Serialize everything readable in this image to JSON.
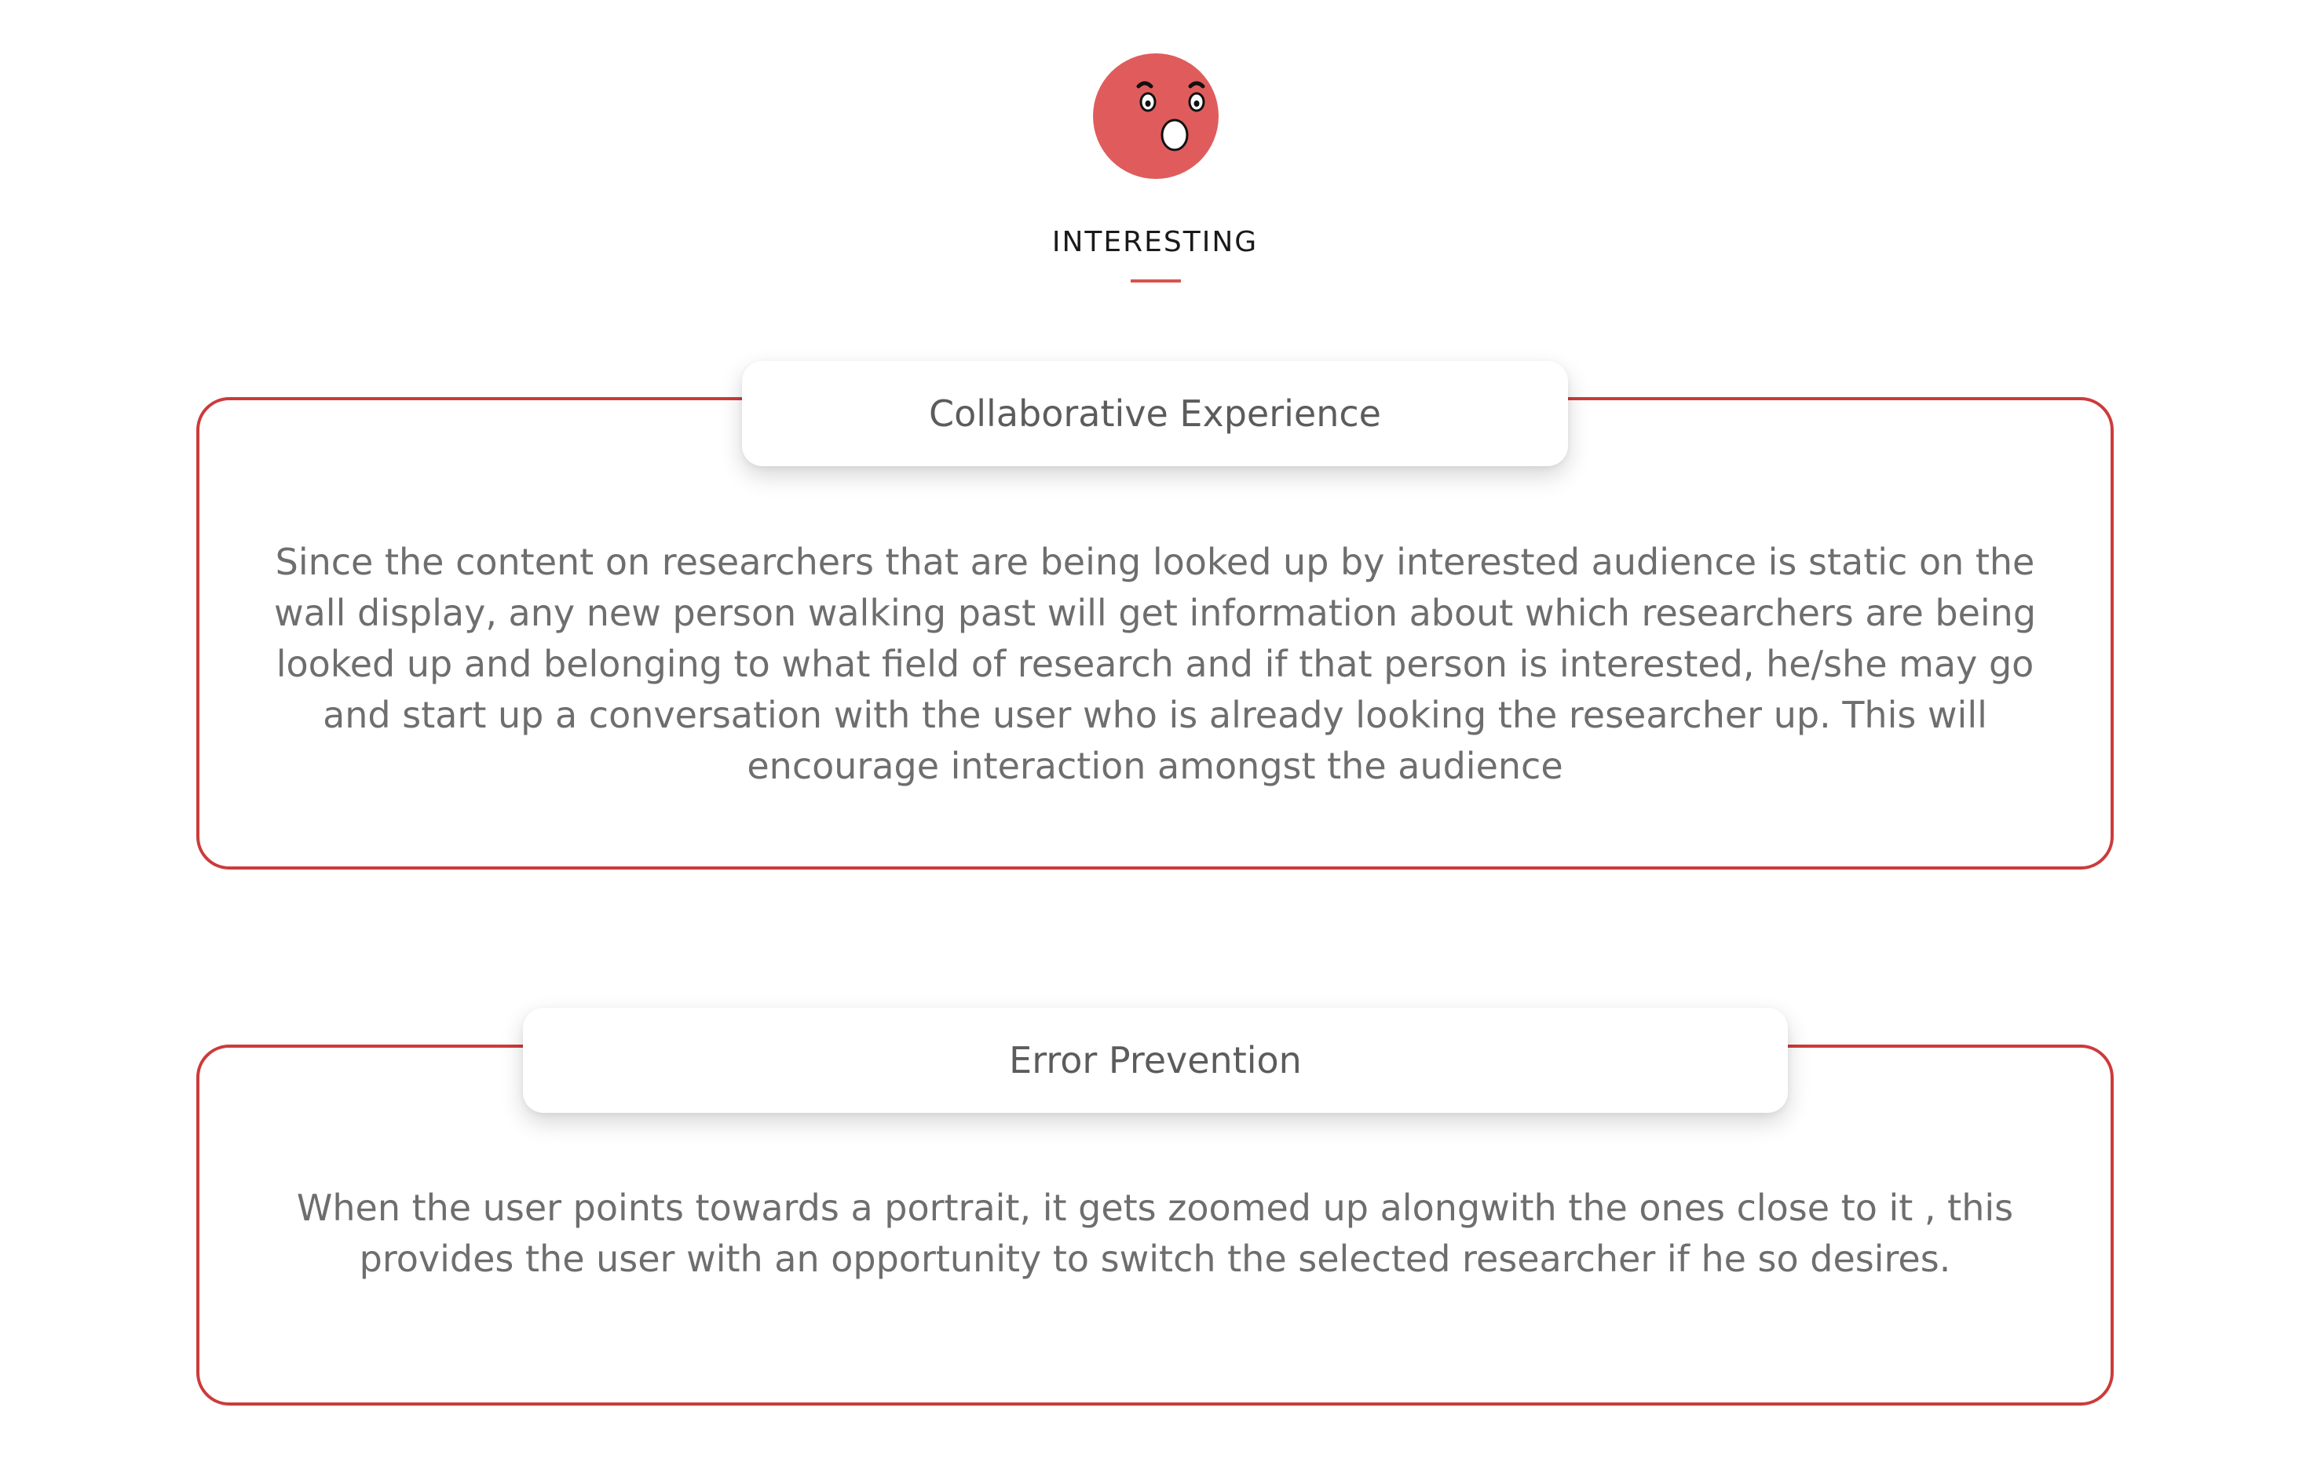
{
  "section": {
    "icon": "surprised-face-icon",
    "title": "INTERESTING",
    "accent_color": "#cc3b3b",
    "icon_color": "#e05c5c"
  },
  "cards": [
    {
      "title": "Collaborative Experience",
      "body": "Since the content on researchers that are being looked up by interested audience is static on the wall display, any new person walking past will get information about which researchers are being looked up and belonging to what field of research and if that person is interested, he/she may go and start up a conversation with the user who is already looking the researcher up. This will encourage interaction amongst the audience"
    },
    {
      "title": "Error Prevention",
      "body": "When the user points towards a portrait, it gets zoomed up alongwith the ones close to it , this provides the user with an opportunity to switch the selected researcher if he so desires."
    }
  ]
}
